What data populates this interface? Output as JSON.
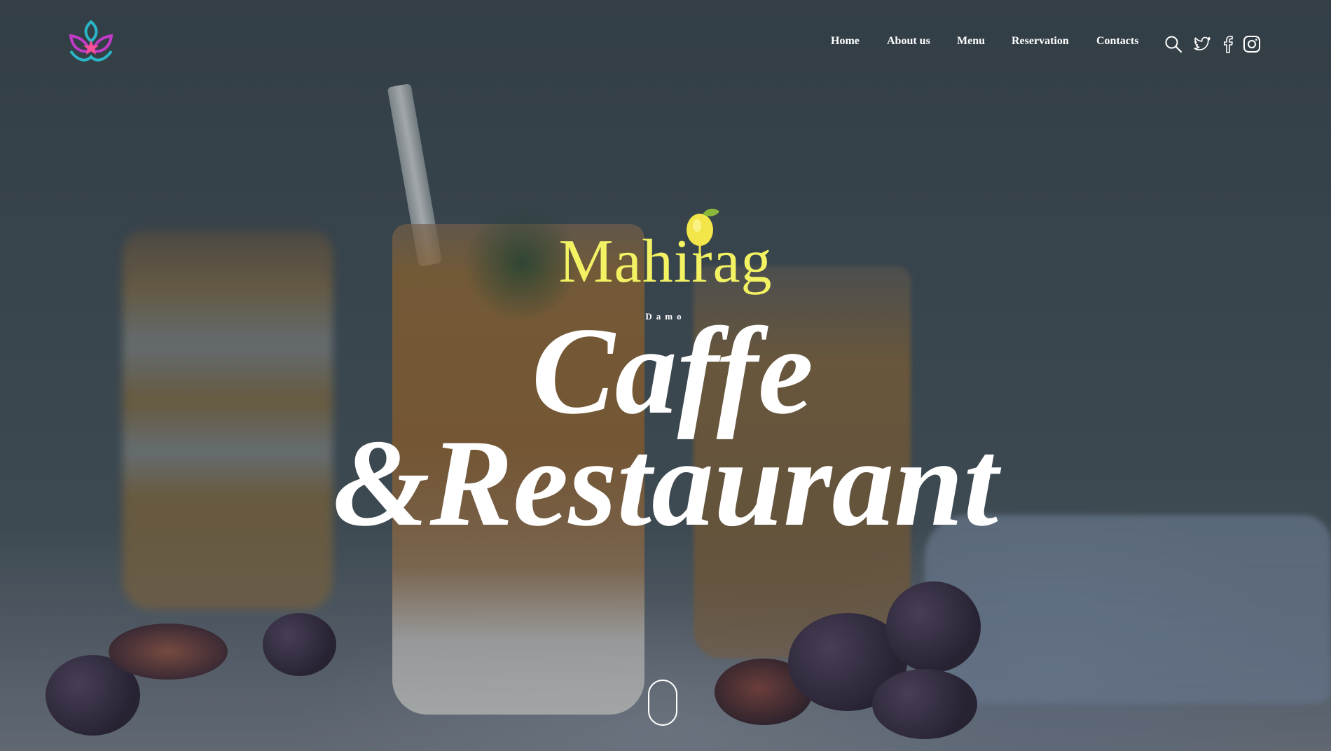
{
  "header": {
    "nav": {
      "home": "Home",
      "about": "About us",
      "menu": "Menu",
      "reservation": "Reservation",
      "contacts": "Contacts"
    },
    "icons": [
      "search-icon",
      "twitter-icon",
      "facebook-icon",
      "instagram-icon"
    ]
  },
  "hero": {
    "brand": "Mahirag",
    "sub_label": "Damo",
    "title_line1": "Caffe",
    "title_line2": "&Restaurant"
  },
  "colors": {
    "brand_yellow": "#f2f263",
    "text_white": "#ffffff",
    "logo_teal": "#2bb5c6",
    "logo_magenta": "#c13bc8",
    "logo_pink": "#ff4f9a"
  }
}
